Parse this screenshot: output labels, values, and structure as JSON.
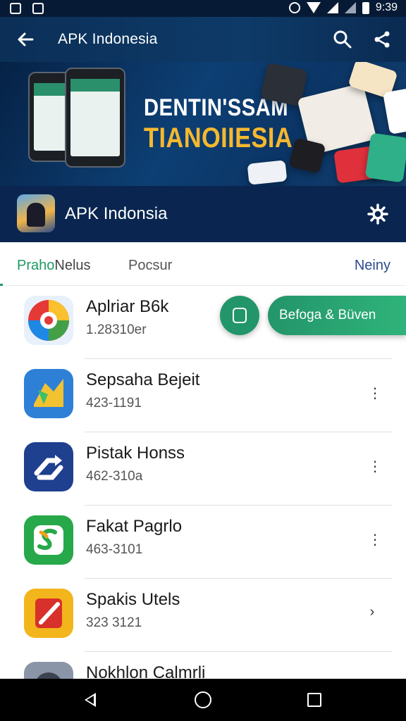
{
  "status_bar": {
    "time": "9:39",
    "icons": [
      "notification-icon",
      "notification-icon",
      "alarm-icon",
      "wifi-icon",
      "signal-icon",
      "battery-icon"
    ]
  },
  "app_bar": {
    "title": "APK Indonesia",
    "icons": [
      "back-arrow-icon",
      "search-icon",
      "share-icon"
    ]
  },
  "banner": {
    "line1": "DENTIN'SSAM",
    "line2": "TIANOIIESIA",
    "accent_color": "#f5b82e"
  },
  "app_header": {
    "name": "APK Indonsia",
    "icon": "settings-icon"
  },
  "tabs": [
    {
      "label_a": "Praho",
      "label_b": "Nelus"
    },
    {
      "label": "Pocsur"
    },
    {
      "label": "Neiny"
    }
  ],
  "list": [
    {
      "title": "Aplriar B6k",
      "subtitle": "1.28310er",
      "icon": "swirl-app-icon",
      "icon_bg": "#e8f0fb"
    },
    {
      "title": "Sepsaha Bejeit",
      "subtitle": "423-1191",
      "more": "⋮",
      "icon": "map-app-icon",
      "icon_bg": "#2e7fd6"
    },
    {
      "title": "Pistak Honss",
      "subtitle": "462-310a",
      "more": "⋮",
      "icon": "sync-app-icon",
      "icon_bg": "#1f3f8f"
    },
    {
      "title": "Fakat Pagrlo",
      "subtitle": "463-3101",
      "more": "⋮",
      "icon": "s-app-icon",
      "icon_bg": "#27a84a"
    },
    {
      "title": "Spakis Utels",
      "subtitle": "323 3121",
      "more": "›",
      "icon": "slash-app-icon",
      "icon_bg": "#f2b51c"
    },
    {
      "title": "Nokhlon Calmrli",
      "subtitle": "",
      "more": "",
      "icon": "camera-app-icon",
      "icon_bg": "#8a96a8"
    }
  ],
  "fab": {
    "label": "Befoga & Büven",
    "color": "#22966a"
  },
  "nav_bar": {
    "icons": [
      "back-icon",
      "home-icon",
      "recents-icon"
    ]
  }
}
